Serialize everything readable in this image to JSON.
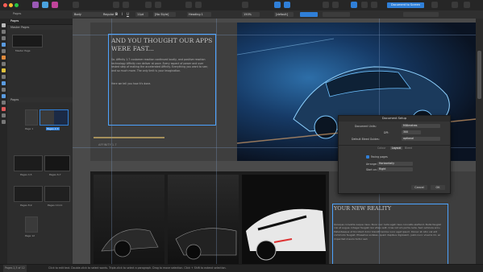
{
  "titlebar": {
    "tabs": [
      "Pages"
    ],
    "right_label": "Document to Screen"
  },
  "contextbar": {
    "doc_name": "Body",
    "style": "Regular",
    "font_size": "11pt",
    "color_mode": "[No Style]",
    "heading": "Heading 1",
    "zoom": "150%",
    "unit": "[default]"
  },
  "studio": {
    "tab_pages": "Pages",
    "tab_master": "Master Pages",
    "master_label": "Master Page",
    "section_pages": "Pages",
    "pages": [
      {
        "label": "Page 1"
      },
      {
        "label": "Pages 2,3"
      },
      {
        "label": "Pages 4,5"
      },
      {
        "label": "Pages 6,7"
      },
      {
        "label": "Pages 8,9"
      },
      {
        "label": "Pages 10,11"
      },
      {
        "label": "Page 12"
      }
    ]
  },
  "page_top": {
    "heading": "AND YOU THOUGHT OUR APPS WERE FAST...",
    "body": "So. Affinity 1.7 customer reaction continued loudly, and positive reaction technology Affinity can deliver at pace. Every aspect of power and user tested step of making the accelerated Affinity. Everything you want to see; and so much more. The only limit is your imagination.",
    "sub": "Here we tell you how it's done.",
    "footer": "AFFINITY 1.7"
  },
  "page_bottom": {
    "heading": "YOUR NEW REALITY",
    "body": "Quisque convallis neque risus. Nunc nec nulla eget risus convallis eleifend. Nulla feugiat nisi et augue. Integer feugiat nisi vitae velit. Cras rutrum porta nulla. Sed vehicula arcu. Pellentesque ut tincidunt dolor blandit lacinia nunc eget ipsum. Donec at odio vel elit commodo feugiat. Phasellus sodales, quam dapibus dignissim, justo nunc viverra mi, ac imperdiet mauris tortor sed."
  },
  "dialog": {
    "title": "Document Setup",
    "rows": {
      "units_label": "Document Units:",
      "units_value": "Millimetres",
      "dpi_label": "DPI:",
      "dpi_value": "300",
      "bleed_label": "Default Bleed Guides:",
      "bleed_value": "optional"
    },
    "tabs": [
      "Colour",
      "Layout",
      "Bleed"
    ],
    "facing_label": "Facing pages",
    "arrange_label": "Arrange:",
    "arrange_value": "Horizontally",
    "start_label": "Start on:",
    "start_value": "Right",
    "cancel": "Cancel",
    "ok": "OK"
  },
  "statusbar": {
    "page_indicator": "Pages 2,3 of 12",
    "hint": "Click to edit text. Double-click to select words. Triple-click to select a paragraph. Drag to move selection. Click + Shift to extend selection."
  },
  "colors": {
    "accent": "#2f7fd8",
    "selection": "#4da3ff",
    "page": "#3d3d3d"
  }
}
